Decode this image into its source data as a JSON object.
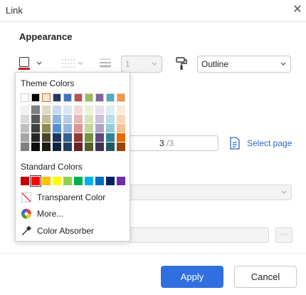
{
  "dialog": {
    "title": "Link",
    "close_glyph": "✕"
  },
  "appearance": {
    "section_title": "Appearance",
    "line_width_value": "1",
    "style_value": "Outline",
    "current_color": "#d01d1d"
  },
  "hidden_fields": {
    "page_current": "3",
    "page_total": "/3",
    "select_page_label": "Select page",
    "more_button_label": "···"
  },
  "popup": {
    "theme_title": "Theme Colors",
    "standard_title": "Standard Colors",
    "transparent_label": "Transparent Color",
    "more_label": "More...",
    "absorber_label": "Color Absorber",
    "theme_top_row": [
      "#ffffff",
      "#000000",
      "#ede8d8",
      "#1f3864",
      "#4472c4",
      "#c0504d",
      "#9bbb59",
      "#8064a2",
      "#4bacc6",
      "#f79646"
    ],
    "theme_columns": [
      [
        "#f2f2f2",
        "#d9d9d9",
        "#bfbfbf",
        "#a6a6a6",
        "#808080"
      ],
      [
        "#7f7f7f",
        "#595959",
        "#404040",
        "#262626",
        "#0d0d0d"
      ],
      [
        "#ddd9c3",
        "#c4bd97",
        "#938953",
        "#4a442a",
        "#1d1b10"
      ],
      [
        "#c6d9f0",
        "#8db3e2",
        "#548dd4",
        "#17365d",
        "#0f243e"
      ],
      [
        "#dbe5f1",
        "#b8cce4",
        "#95b3d7",
        "#366092",
        "#244061"
      ],
      [
        "#f2dcdb",
        "#e5b9b7",
        "#d99694",
        "#953734",
        "#632423"
      ],
      [
        "#ebf1dd",
        "#d7e3bc",
        "#c3d69b",
        "#76923c",
        "#4f6128"
      ],
      [
        "#e5e0ec",
        "#ccc1d9",
        "#b2a2c7",
        "#5f497a",
        "#3f3151"
      ],
      [
        "#dbeef3",
        "#b7dde8",
        "#92cddc",
        "#31859b",
        "#205867"
      ],
      [
        "#fdeada",
        "#fbd5b5",
        "#fac08f",
        "#e36c09",
        "#974806"
      ]
    ],
    "standard_colors": [
      "#c00000",
      "#ff0000",
      "#ffc000",
      "#ffff00",
      "#92d050",
      "#00b050",
      "#00b0f0",
      "#0070c0",
      "#002060",
      "#7030a0"
    ]
  },
  "footer": {
    "apply_label": "Apply",
    "cancel_label": "Cancel"
  }
}
